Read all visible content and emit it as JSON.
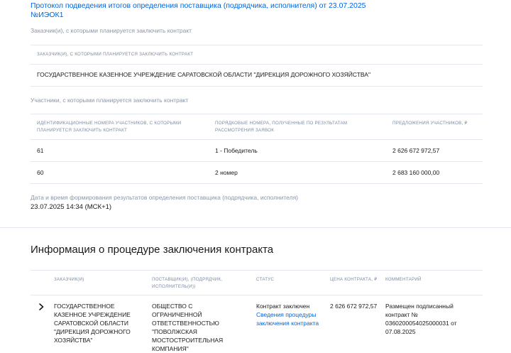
{
  "protocol": {
    "link_line1": "Протокол подведения итогов определения поставщика (подрядчика, исполнителя) от 23.07.2025",
    "link_line2": "№ИЭОК1"
  },
  "customers": {
    "caption": "Заказчик(и), с которыми планируется заключить контракт",
    "header": "ЗАКАЗЧИК(И), С КОТОРЫМИ ПЛАНИРУЕТСЯ ЗАКЛЮЧИТЬ КОНТРАКТ",
    "name": "ГОСУДАРСТВЕННОЕ КАЗЕННОЕ УЧРЕЖДЕНИЕ САРАТОВСКОЙ ОБЛАСТИ \"ДИРЕКЦИЯ ДОРОЖНОГО ХОЗЯЙСТВА\""
  },
  "participants": {
    "caption": "Участники, с которыми планируется заключить контракт",
    "headers": {
      "id_numbers": "ИДЕНТИФИКАЦИОННЫЕ НОМЕРА УЧАСТНИКОВ, С КОТОРЫМИ ПЛАНИРУЕТСЯ ЗАКЛЮЧИТЬ КОНТРАКТ",
      "ordinal": "ПОРЯДКОВЫЕ НОМЕРА, ПОЛУЧЕННЫЕ ПО РЕЗУЛЬТАТАМ РАССМОТРЕНИЯ ЗАЯВОК",
      "offers": "ПРЕДЛОЖЕНИЯ УЧАСТНИКОВ, ₽"
    },
    "rows": [
      {
        "id": "61",
        "ordinal": "1 - Победитель",
        "offer": "2 626 672 972,57"
      },
      {
        "id": "60",
        "ordinal": "2 номер",
        "offer": "2 683 160 000,00"
      }
    ]
  },
  "results_datetime": {
    "caption": "Дата и время формирования результатов определения поставщика (подрядчика, исполнителя)",
    "value": "23.07.2025 14:34 (МСК+1)"
  },
  "contract_info": {
    "title": "Информация о процедуре заключения контракта",
    "headers": {
      "customer": "ЗАКАЗЧИК(И)",
      "supplier": "ПОСТАВЩИК(И), (ПОДРЯДЧИК, ИСПОЛНИТЕЛЬ(И))",
      "status": "СТАТУС",
      "price": "ЦЕНА КОНТРАКТА, ₽",
      "comment": "КОММЕНТАРИЙ"
    },
    "row": {
      "customer": "ГОСУДАРСТВЕННОЕ КАЗЕННОЕ УЧРЕЖДЕНИЕ САРАТОВСКОЙ ОБЛАСТИ \"ДИРЕКЦИЯ ДОРОЖНОГО ХОЗЯЙСТВА\"",
      "supplier": "ОБЩЕСТВО С ОГРАНИЧЕННОЙ ОТВЕТСТВЕННОСТЬЮ \"ПОВОЛЖСКАЯ МОСТОСТРОИТЕЛЬНАЯ КОМПАНИЯ\"",
      "status": "Контракт заключен",
      "status_link": "Сведения процедуры заключения контракта",
      "price": "2 626 672 972,57",
      "comment": "Размещен подписанный контракт № 0360200054025000031 от 07.08.2025"
    }
  },
  "icons": {
    "expand": "chevron-right-icon"
  },
  "colors": {
    "link": "#0065dd",
    "caption": "#8a96a8",
    "divider": "#e4e7f2"
  }
}
